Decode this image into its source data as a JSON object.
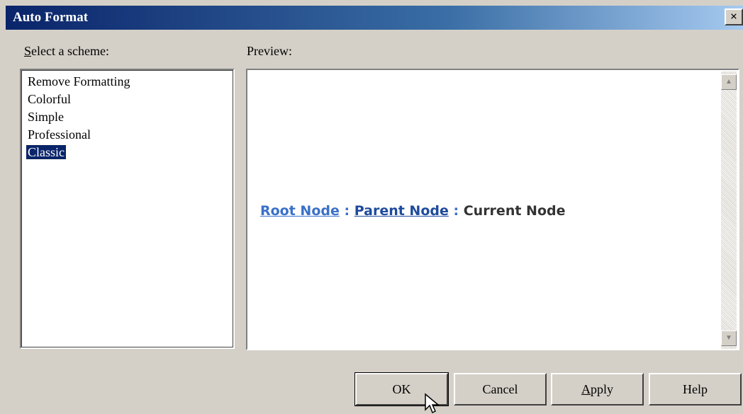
{
  "window": {
    "title": "Auto Format",
    "close_label": "×"
  },
  "scheme": {
    "label_prefix": "S",
    "label_rest": "elect a scheme:",
    "items": [
      {
        "label": "Remove Formatting",
        "selected": false
      },
      {
        "label": "Colorful",
        "selected": false
      },
      {
        "label": "Simple",
        "selected": false
      },
      {
        "label": "Professional",
        "selected": false
      },
      {
        "label": "Classic",
        "selected": true
      }
    ]
  },
  "preview": {
    "label": "Preview:",
    "root": "Root Node",
    "sep1": " : ",
    "parent": "Parent Node",
    "sep2": " : ",
    "current": "Current Node",
    "scroll_up_icon": "arrow-up-icon",
    "scroll_down_icon": "arrow-down-icon"
  },
  "buttons": {
    "ok": "OK",
    "cancel": "Cancel",
    "apply_prefix": "A",
    "apply_rest": "pply",
    "help": "Help"
  },
  "colors": {
    "title_bar_start": "#0a246a",
    "selection": "#0a246a",
    "root_link": "#3a70c8",
    "parent_link": "#1e4a9c",
    "current_text": "#333333"
  }
}
